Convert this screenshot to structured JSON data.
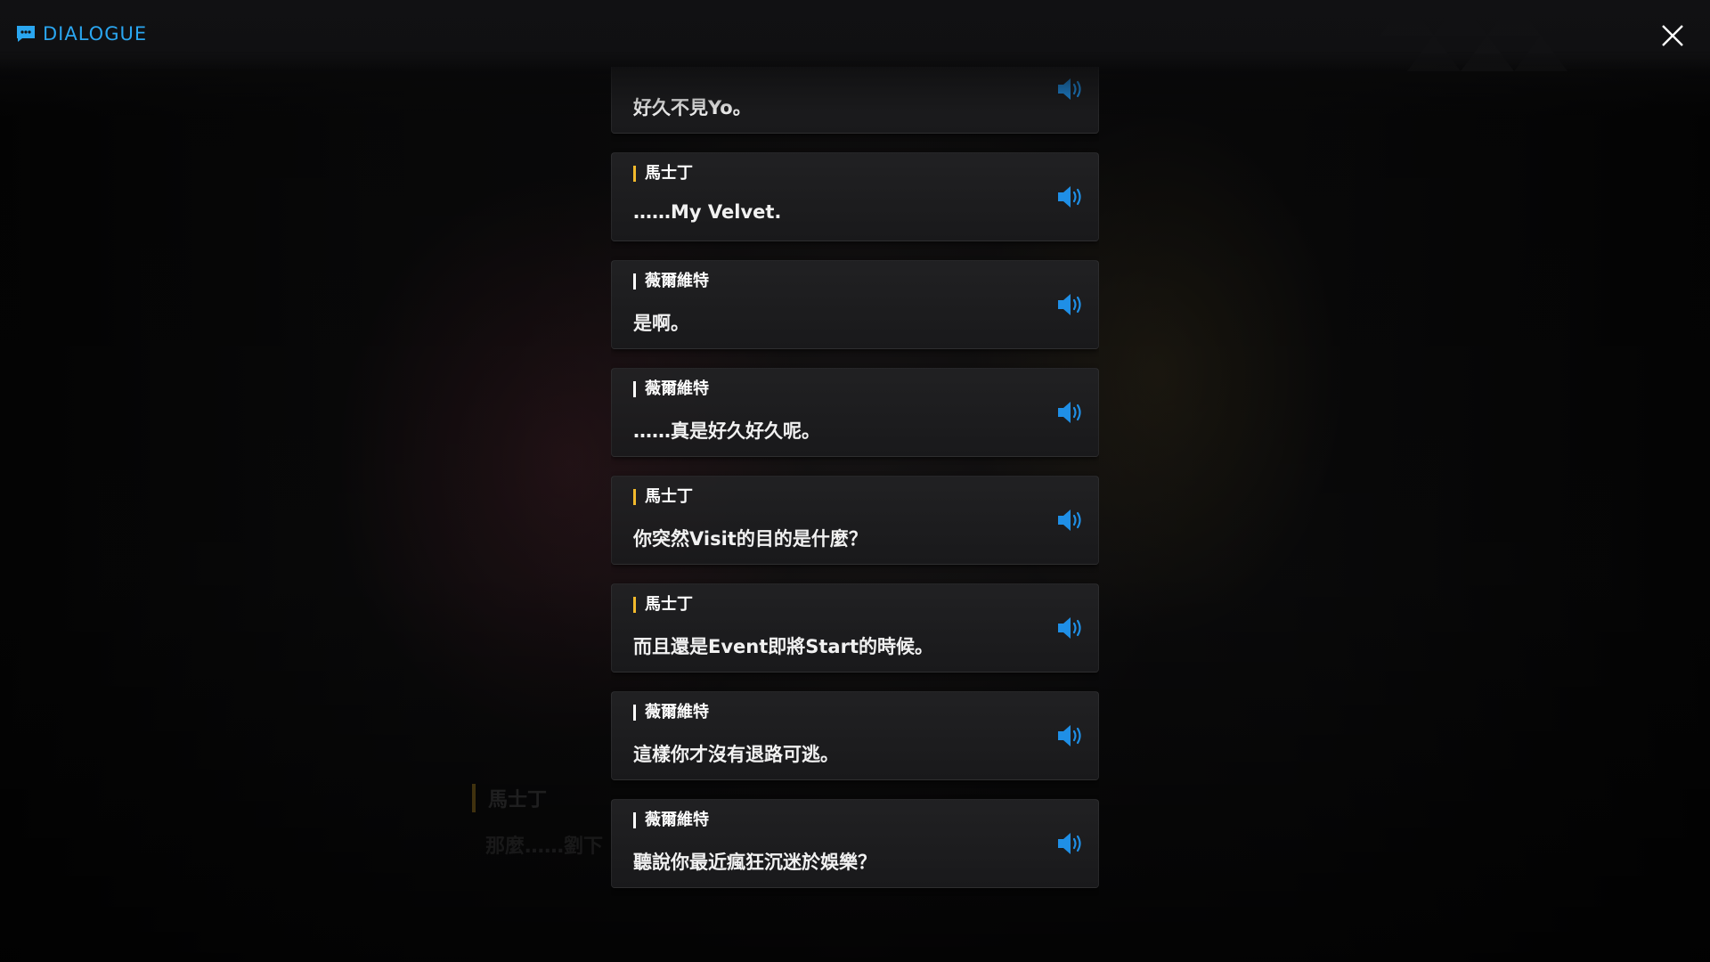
{
  "header": {
    "title": "DIALOGUE",
    "icon": "chat-icon",
    "close_icon": "close-icon"
  },
  "colors": {
    "accent": "#2aa6f0",
    "gold_marker": "#f2b92c",
    "white_marker": "#ffffff"
  },
  "ghost": {
    "speaker": "馬士丁",
    "text": "那麼……劉下"
  },
  "dialogues": [
    {
      "speaker": "",
      "marker": "gold",
      "text": "好久不見Yo。"
    },
    {
      "speaker": "馬士丁",
      "marker": "gold",
      "text": "……My Velvet."
    },
    {
      "speaker": "薇爾維特",
      "marker": "white",
      "text": "是啊。"
    },
    {
      "speaker": "薇爾維特",
      "marker": "white",
      "text": "……真是好久好久呢。"
    },
    {
      "speaker": "馬士丁",
      "marker": "gold",
      "text": "你突然Visit的目的是什麼？"
    },
    {
      "speaker": "馬士丁",
      "marker": "gold",
      "text": "而且還是Event即將Start的時候。"
    },
    {
      "speaker": "薇爾維特",
      "marker": "white",
      "text": "這樣你才沒有退路可逃。"
    },
    {
      "speaker": "薇爾維特",
      "marker": "white",
      "text": "聽說你最近瘋狂沉迷於娛樂？"
    }
  ]
}
